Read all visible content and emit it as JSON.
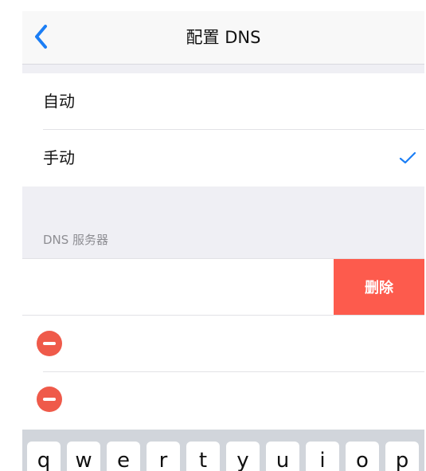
{
  "navbar": {
    "title": "配置 DNS",
    "back_icon": "chevron-left-icon"
  },
  "dns_mode": {
    "options": [
      {
        "label": "自动",
        "selected": false
      },
      {
        "label": "手动",
        "selected": true
      }
    ],
    "check_icon": "checkmark-icon",
    "accent_color": "#1b7ef5"
  },
  "dns_servers": {
    "header": "DNS 服务器",
    "delete_label": "删除",
    "delete_color": "#fd5b4d",
    "remove_icon": "minus-circle-icon",
    "entries": [
      {
        "value": ""
      },
      {
        "value": ""
      },
      {
        "value": ""
      }
    ]
  },
  "keyboard": {
    "keys": [
      "q",
      "w",
      "e",
      "r",
      "t",
      "y",
      "u",
      "i",
      "o",
      "p"
    ]
  }
}
